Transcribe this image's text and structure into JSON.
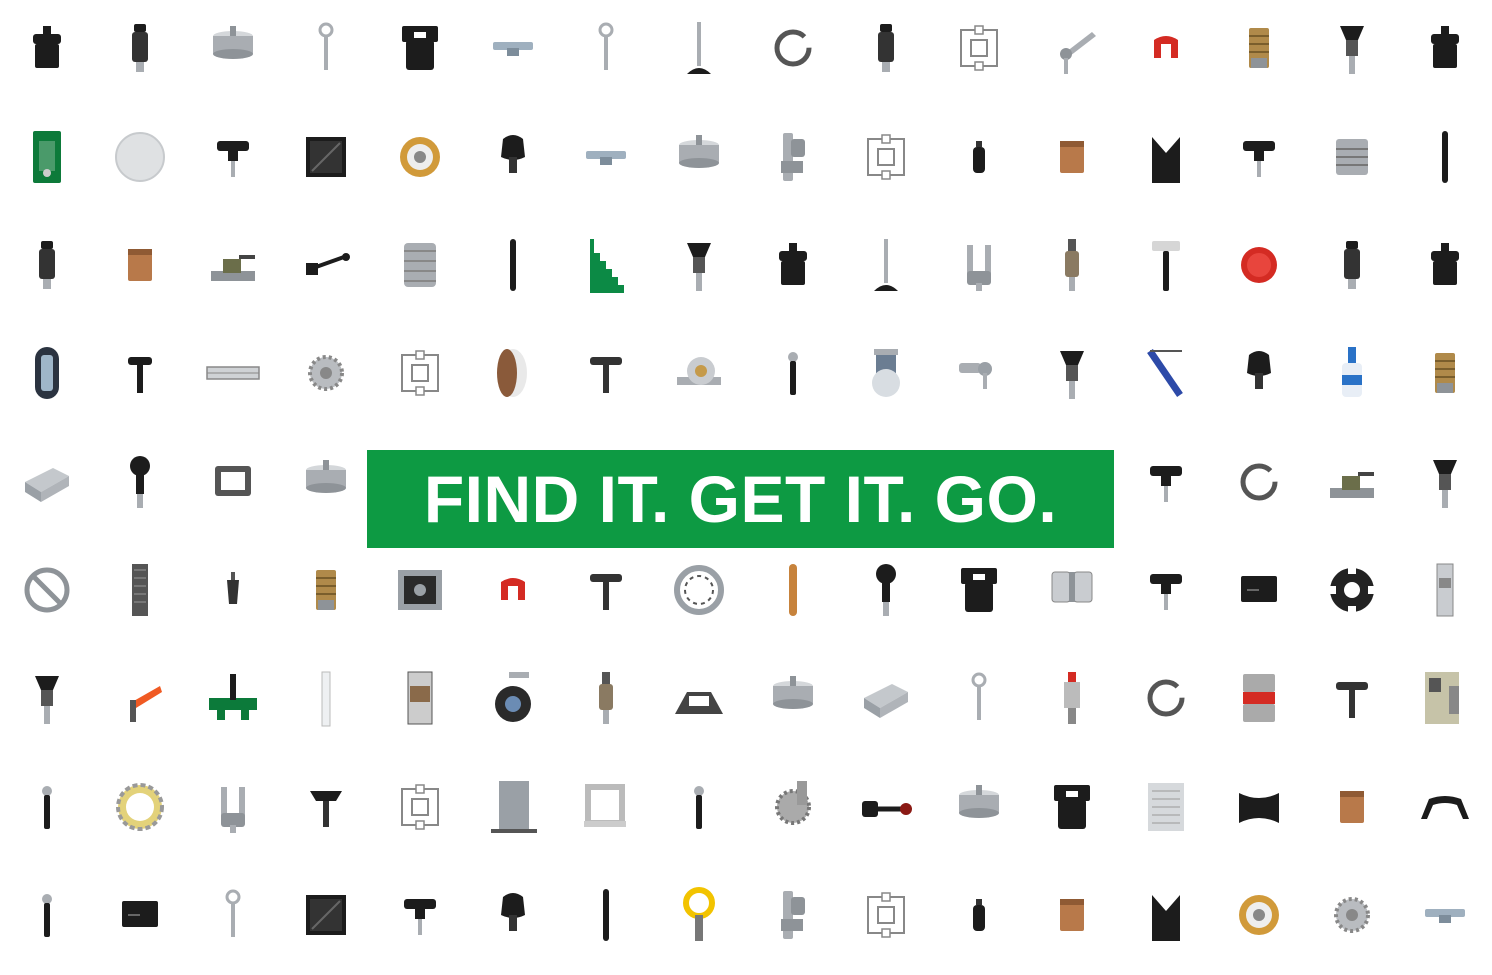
{
  "banner": {
    "text": "FIND IT. GET IT. GO.",
    "background_color": "#0d9a43",
    "text_color": "#ffffff"
  },
  "palette": {
    "black": "#1c1c1c",
    "steel": "#a9adb2",
    "brass": "#b08a4a",
    "copper": "#b8794a",
    "green": "#0d7a3a",
    "red": "#d42b23",
    "orange": "#f05a23",
    "yellow": "#f2c300",
    "blue": "#2d4aa8"
  },
  "grid": {
    "rows": [
      [
        "clamping-knob",
        "plunger-pin",
        "cup-base",
        "eye-bolt",
        "hinge-block",
        "t-slot-nut",
        "eye-bolt",
        "leveling-foot",
        "retaining-ring",
        "plunger-pin",
        "profile-section",
        "adjustable-lever",
        "u-clip-red",
        "brass-insert",
        "indexing-plunger",
        "clamping-knob"
      ],
      [
        "sight-glass-green",
        "acrylic-disc",
        "t-knob",
        "corner-bracket",
        "roller-bearing",
        "grip-knob",
        "t-slot-nut",
        "cup-base",
        "hinge-bracket",
        "profile-section",
        "screw-plunger",
        "brass-bushing",
        "v-block",
        "t-knob",
        "flexible-coupling",
        "long-pin"
      ],
      [
        "plunger-pin",
        "brass-bushing",
        "toggle-clamp",
        "crank-handle",
        "timing-pulley",
        "long-pin",
        "step-block-green",
        "indexing-plunger",
        "clamping-knob",
        "leveling-foot",
        "clevis",
        "spring-plunger",
        "hammer",
        "red-cap",
        "plunger-pin",
        "clamping-knob"
      ],
      [
        "level-indicator",
        "l-handle",
        "rail-profile",
        "gear",
        "profile-section",
        "tape-roll",
        "t-handle",
        "pillow-block",
        "pin",
        "caster-fixed",
        "ball-joint",
        "indexing-plunger",
        "gas-spring-blue",
        "grip-knob",
        "adhesive-bottle",
        "brass-insert"
      ],
      [
        "aluminum-profile",
        "ball-handle",
        "rectangle-frame",
        "cup-base",
        "",
        "",
        "",
        "",
        "",
        "",
        "",
        "",
        "t-knob",
        "retaining-ring",
        "toggle-clamp",
        "indexing-plunger"
      ],
      [
        "handwheel",
        "linear-rail",
        "small-pin",
        "brass-insert",
        "bearing-housing",
        "u-clip-red",
        "t-handle",
        "ball-bearing",
        "copper-pin",
        "ball-handle",
        "hinge-block",
        "hinge-plate",
        "t-knob",
        "black-block",
        "spider-coupling",
        "linear-actuator"
      ],
      [
        "indexing-plunger",
        "adjustable-lever-orange",
        "swing-clamp-green",
        "ruler",
        "linear-guide",
        "caster-swivel",
        "spring-plunger",
        "toggle-base",
        "cup-base",
        "aluminum-profile",
        "eye-bolt",
        "spring-plunger-red",
        "retaining-ring",
        "jaw-coupling",
        "t-handle",
        "actuator-module"
      ],
      [
        "pin",
        "locking-ring",
        "clevis",
        "wing-knob",
        "profile-section",
        "steel-plate",
        "bracket-frame",
        "pin",
        "bevel-gear",
        "ball-lever",
        "cup-base",
        "hinge-block",
        "heat-sink",
        "roller-black",
        "brass-bushing",
        "handle-black"
      ],
      [
        "pin",
        "black-block",
        "eye-bolt",
        "corner-bracket",
        "t-knob",
        "grip-knob",
        "long-pin",
        "lifting-ring-yellow",
        "hinge-bracket",
        "profile-section",
        "screw-plunger",
        "brass-bushing",
        "v-block",
        "roller-bearing",
        "gear",
        "t-slot-nut"
      ]
    ]
  }
}
